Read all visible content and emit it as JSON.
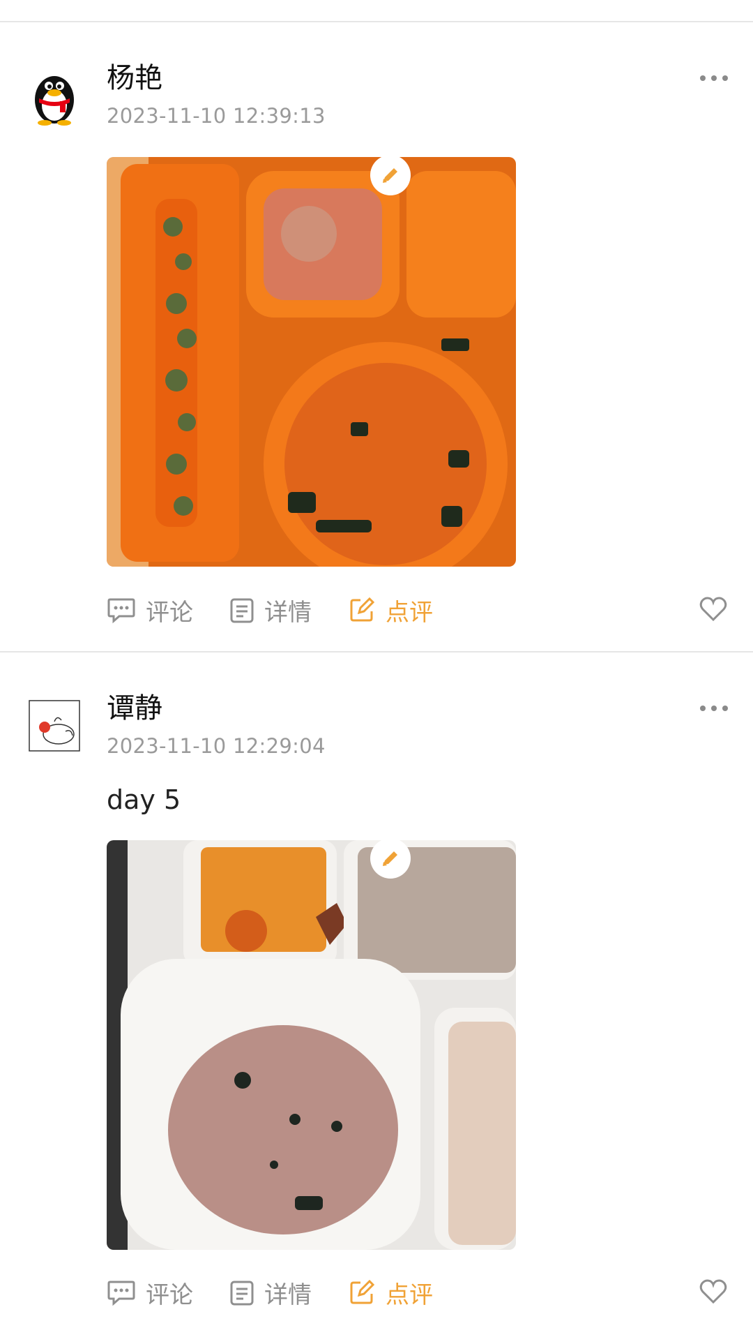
{
  "posts": [
    {
      "author": "杨艳",
      "time": "2023-11-10 12:39:13",
      "text": "",
      "actions": {
        "comment": "评论",
        "detail": "详情",
        "review": "点评"
      }
    },
    {
      "author": "谭静",
      "time": "2023-11-10 12:29:04",
      "text": "day 5",
      "actions": {
        "comment": "评论",
        "detail": "详情",
        "review": "点评"
      }
    }
  ],
  "colors": {
    "accent": "#f0a236",
    "muted": "#8f8f8f",
    "divider": "#e6e6e6"
  }
}
